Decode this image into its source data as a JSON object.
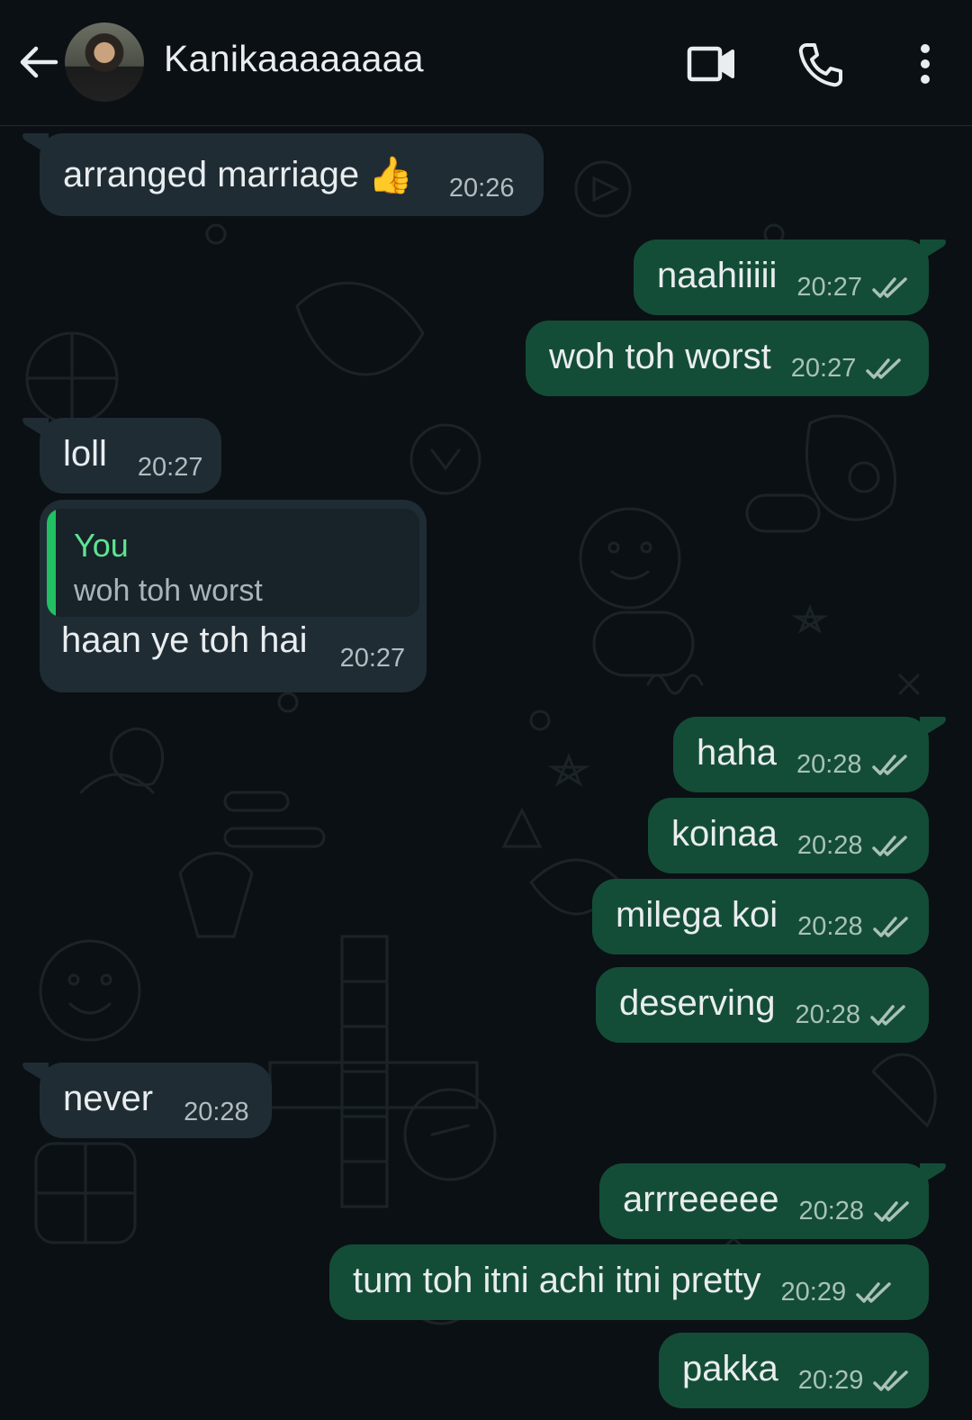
{
  "header": {
    "contact_name": "Kanikaaaaaaaa",
    "back_icon": "arrow-left-icon",
    "video_icon": "video-call-icon",
    "call_icon": "phone-icon",
    "menu_icon": "more-vertical-icon"
  },
  "colors": {
    "incoming_bubble": "#1f2c34",
    "outgoing_bubble": "#144d37",
    "reply_accent": "#21c063",
    "background": "#0b1014"
  },
  "messages": [
    {
      "dir": "in",
      "text": "arranged marriage",
      "emoji": "👍",
      "time": "20:26"
    },
    {
      "dir": "out",
      "text": "naahiiiii",
      "time": "20:27",
      "status": "read"
    },
    {
      "dir": "out",
      "text": "woh toh worst",
      "time": "20:27",
      "status": "read"
    },
    {
      "dir": "in",
      "text": "loll",
      "time": "20:27"
    },
    {
      "dir": "in",
      "reply_to": {
        "author": "You",
        "text": "woh toh worst"
      },
      "text": "haan ye toh hai",
      "time": "20:27"
    },
    {
      "dir": "out",
      "text": "haha",
      "time": "20:28",
      "status": "read"
    },
    {
      "dir": "out",
      "text": "koinaa",
      "time": "20:28",
      "status": "read"
    },
    {
      "dir": "out",
      "text": "milega koi",
      "time": "20:28",
      "status": "read"
    },
    {
      "dir": "out",
      "text": "deserving",
      "time": "20:28",
      "status": "read"
    },
    {
      "dir": "in",
      "text": "never",
      "time": "20:28"
    },
    {
      "dir": "out",
      "text": "arrreeeee",
      "time": "20:28",
      "status": "read"
    },
    {
      "dir": "out",
      "text": "tum toh itni achi itni pretty",
      "time": "20:29",
      "status": "read"
    },
    {
      "dir": "out",
      "text": "pakka",
      "time": "20:29",
      "status": "read"
    }
  ]
}
